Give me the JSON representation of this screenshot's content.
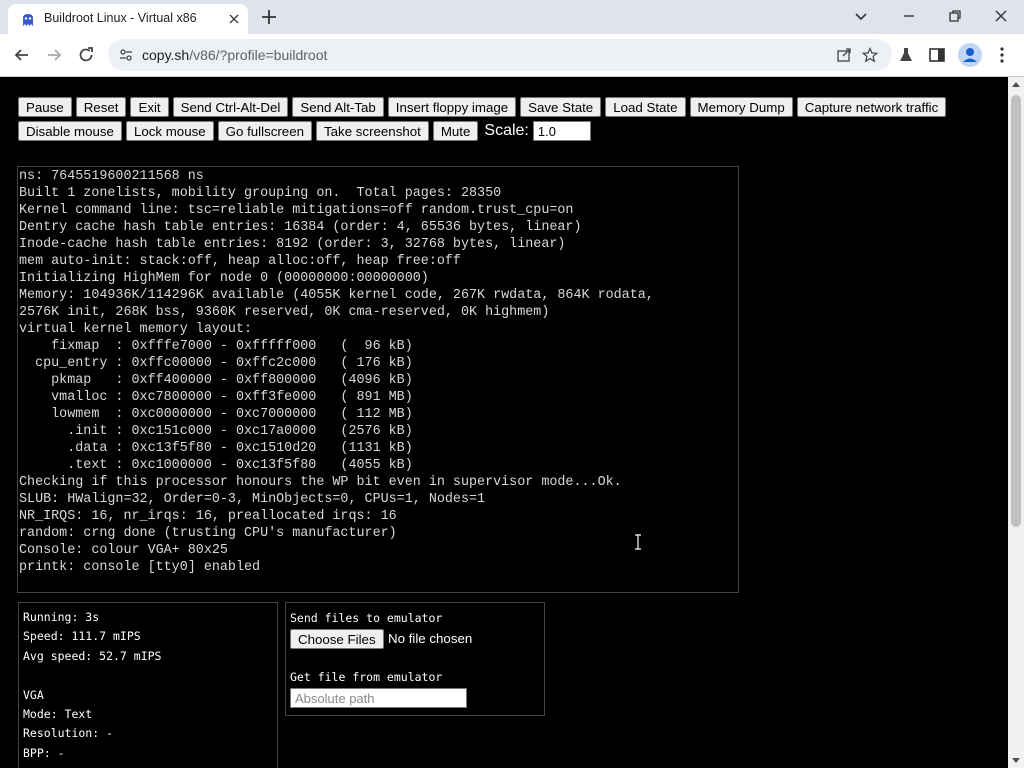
{
  "browser": {
    "tab_title": "Buildroot Linux - Virtual x86",
    "url_host": "copy.sh",
    "url_path": "/v86/?profile=buildroot"
  },
  "buttons_row1": [
    "Pause",
    "Reset",
    "Exit",
    "Send Ctrl-Alt-Del",
    "Send Alt-Tab",
    "Insert floppy image",
    "Save State",
    "Load State",
    "Memory Dump",
    "Capture network traffic"
  ],
  "buttons_row2": [
    "Disable mouse",
    "Lock mouse",
    "Go fullscreen",
    "Take screenshot",
    "Mute"
  ],
  "scale": {
    "label": "Scale:",
    "value": "1.0"
  },
  "console_lines": [
    "ns: 7645519600211568 ns",
    "Built 1 zonelists, mobility grouping on.  Total pages: 28350",
    "Kernel command line: tsc=reliable mitigations=off random.trust_cpu=on",
    "Dentry cache hash table entries: 16384 (order: 4, 65536 bytes, linear)",
    "Inode-cache hash table entries: 8192 (order: 3, 32768 bytes, linear)",
    "mem auto-init: stack:off, heap alloc:off, heap free:off",
    "Initializing HighMem for node 0 (00000000:00000000)",
    "Memory: 104936K/114296K available (4055K kernel code, 267K rwdata, 864K rodata,",
    "2576K init, 268K bss, 9360K reserved, 0K cma-reserved, 0K highmem)",
    "virtual kernel memory layout:",
    "    fixmap  : 0xfffe7000 - 0xfffff000   (  96 kB)",
    "  cpu_entry : 0xffc00000 - 0xffc2c000   ( 176 kB)",
    "    pkmap   : 0xff400000 - 0xff800000   (4096 kB)",
    "    vmalloc : 0xc7800000 - 0xff3fe000   ( 891 MB)",
    "    lowmem  : 0xc0000000 - 0xc7000000   ( 112 MB)",
    "      .init : 0xc151c000 - 0xc17a0000   (2576 kB)",
    "      .data : 0xc13f5f80 - 0xc1510d20   (1131 kB)",
    "      .text : 0xc1000000 - 0xc13f5f80   (4055 kB)",
    "Checking if this processor honours the WP bit even in supervisor mode...Ok.",
    "SLUB: HWalign=32, Order=0-3, MinObjects=0, CPUs=1, Nodes=1",
    "NR_IRQS: 16, nr_irqs: 16, preallocated irqs: 16",
    "random: crng done (trusting CPU's manufacturer)",
    "Console: colour VGA+ 80x25",
    "printk: console [tty0] enabled"
  ],
  "info_lines": [
    "Running: 3s",
    "Speed: 111.7 mIPS",
    "Avg speed: 52.7 mIPS",
    "",
    "VGA",
    "Mode: Text",
    "Resolution: -",
    "BPP: -"
  ],
  "files": {
    "send_label": "Send files to emulator",
    "choose_label": "Choose Files",
    "no_file": "No file chosen",
    "get_label": "Get file from emulator",
    "path_placeholder": "Absolute path"
  }
}
